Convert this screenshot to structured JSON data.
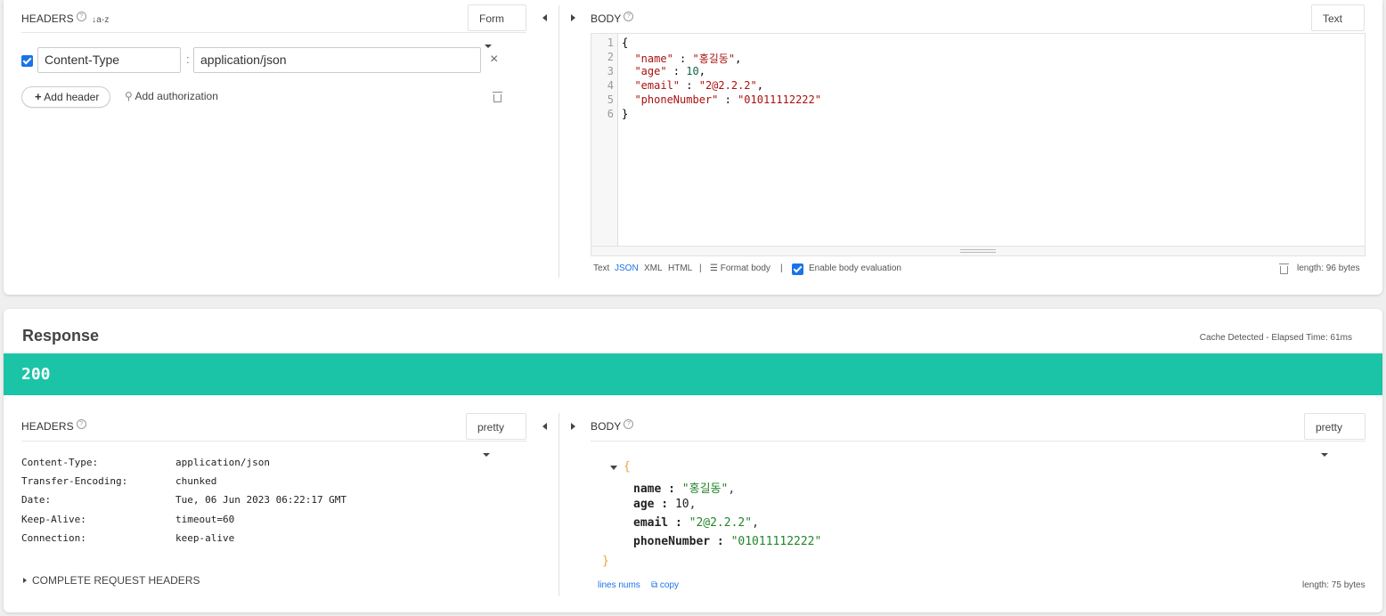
{
  "request": {
    "headers_section": {
      "title": "HEADERS",
      "help": "?",
      "sort_icon": "↓a-z",
      "mode": "Form",
      "rows": [
        {
          "enabled": true,
          "name": "Content-Type",
          "separator": ":",
          "value": "application/json",
          "remove": "×"
        }
      ],
      "add_header_label": "Add header",
      "add_auth_label": "Add authorization"
    },
    "body_section": {
      "title": "BODY",
      "help": "?",
      "mode": "Text",
      "line_numbers": [
        "1",
        "2",
        "3",
        "4",
        "5",
        "6"
      ],
      "code_lines": [
        [
          "{"
        ],
        [
          "  ",
          "\"name\"",
          " : ",
          "\"홍길동\"",
          ","
        ],
        [
          "  ",
          "\"age\"",
          " : ",
          "10",
          ","
        ],
        [
          "  ",
          "\"email\"",
          " : ",
          "\"2@2.2.2\"",
          ","
        ],
        [
          "  ",
          "\"phoneNumber\"",
          " : ",
          "\"01011112222\""
        ],
        [
          "}"
        ]
      ],
      "formats": [
        "Text",
        "JSON",
        "XML",
        "HTML"
      ],
      "selected_format": "JSON",
      "divider": "|",
      "format_body_label": "Format body",
      "enable_eval_label": "Enable body evaluation",
      "length": "length: 96 bytes"
    }
  },
  "response": {
    "title": "Response",
    "elapsed": "Cache Detected - Elapsed Time: 61ms",
    "status": "200",
    "status_color": "#1bc4a6",
    "headers_section": {
      "title": "HEADERS",
      "help": "?",
      "mode": "pretty",
      "rows": [
        {
          "key": "Content-Type:",
          "value": "application/json"
        },
        {
          "key": "Transfer-Encoding:",
          "value": "chunked"
        },
        {
          "key": "Date:",
          "value": "Tue, 06 Jun 2023 06:22:17 GMT"
        },
        {
          "key": "Keep-Alive:",
          "value": "timeout=60"
        },
        {
          "key": "Connection:",
          "value": "keep-alive"
        }
      ],
      "complete_request_label": "COMPLETE REQUEST HEADERS"
    },
    "body_section": {
      "title": "BODY",
      "help": "?",
      "mode": "pretty",
      "open_brace": "{",
      "close_brace": "}",
      "entries": [
        {
          "key": "name",
          "sep": " :  ",
          "value": "\"홍길동\"",
          "trail": ",",
          "kind": "string"
        },
        {
          "key": "age",
          "sep": " :  ",
          "value": "10",
          "trail": ",",
          "kind": "number"
        },
        {
          "key": "email",
          "sep": " :  ",
          "value": "\"2@2.2.2\"",
          "trail": ",",
          "kind": "string"
        },
        {
          "key": "phoneNumber",
          "sep": " :  ",
          "value": "\"01011112222\"",
          "trail": "",
          "kind": "string"
        }
      ],
      "lines_nums_label": "lines nums",
      "copy_label": "copy",
      "length": "length: 75 bytes"
    }
  }
}
